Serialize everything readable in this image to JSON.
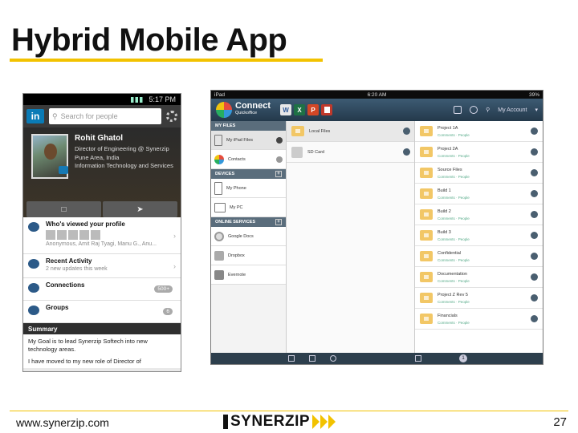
{
  "slide": {
    "title": "Hybrid Mobile App",
    "footer_url": "www.synerzip.com",
    "logo_text": "SYNERZIP",
    "page_number": "27",
    "accent_color": "#f2c200"
  },
  "linkedin_app": {
    "status_time": "5:17 PM",
    "logo": "in",
    "search_placeholder": "Search for people",
    "profile": {
      "name": "Rohit Ghatol",
      "title": "Director of Engineering @ Synerzip",
      "location": "Pune Area, India",
      "industry": "Information Technology and Services"
    },
    "rows": [
      {
        "title": "Who's viewed your profile",
        "subtitle": "Anonymous, Amit Raj Tyagi, Manu G., Anu..."
      },
      {
        "title": "Recent Activity",
        "subtitle": "2 new updates this week"
      },
      {
        "title": "Connections",
        "count": "500+"
      },
      {
        "title": "Groups",
        "count": "6"
      }
    ],
    "summary_header": "Summary",
    "summary_lines": [
      "My Goal is to lead Synerzip Softech into new technology areas.",
      "I have moved to my new role of Director of"
    ],
    "brand_color": "#0a7bb6"
  },
  "connect_app": {
    "status_left": "iPad",
    "status_time": "6:20 AM",
    "status_right": "39%",
    "app_name": "Connect",
    "app_subtitle": "Quickoffice",
    "tiles": [
      "W",
      "X",
      "P",
      ""
    ],
    "account_label": "My Account",
    "sections": {
      "my_files": "MY FILES",
      "devices": "DEVICES",
      "online": "ONLINE SERVICES"
    },
    "my_files_items": [
      "My iPad Files",
      "Contacts"
    ],
    "device_items": [
      "My Phone",
      "My PC"
    ],
    "online_items": [
      "Google Docs",
      "Dropbox",
      "Evernote"
    ],
    "middle_items": [
      "Local Files",
      "SD Card"
    ],
    "projects": [
      {
        "name": "Project 1A",
        "comments": "Comments",
        "people": "People"
      },
      {
        "name": "Project 2A",
        "comments": "Comments",
        "people": "People"
      },
      {
        "name": "Source Files",
        "comments": "Comments",
        "people": "People"
      },
      {
        "name": "Build 1",
        "comments": "Comments",
        "people": "People"
      },
      {
        "name": "Build 2",
        "comments": "Comments",
        "people": "People"
      },
      {
        "name": "Build 3",
        "comments": "Comments",
        "people": "People"
      },
      {
        "name": "Confidential",
        "comments": "Comments",
        "people": "People"
      },
      {
        "name": "Documentation",
        "comments": "Comments",
        "people": "People"
      },
      {
        "name": "Project Z Rev 5",
        "comments": "Comments",
        "people": "People"
      },
      {
        "name": "Financials",
        "comments": "Comments",
        "people": "People"
      }
    ],
    "page_badge": "1"
  }
}
